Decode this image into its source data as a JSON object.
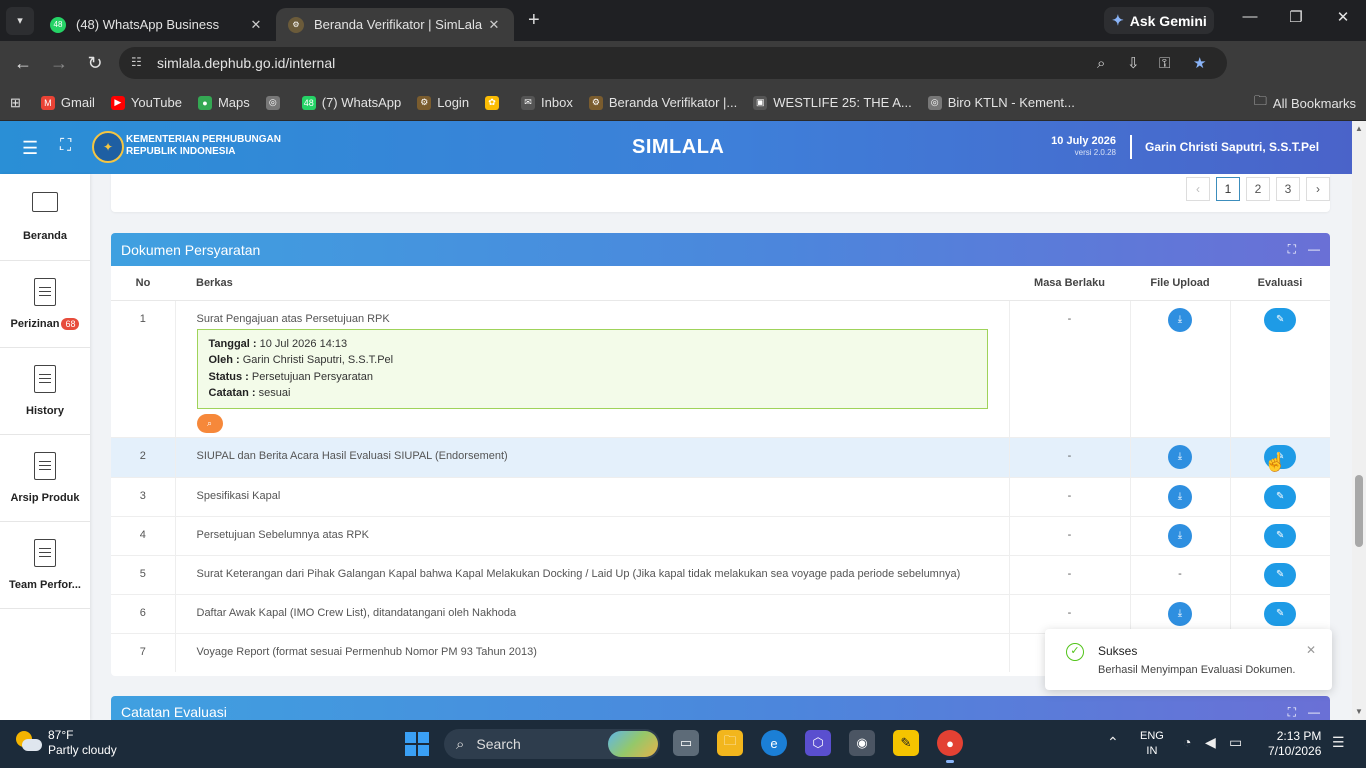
{
  "browser": {
    "tabs": [
      {
        "title": "(48) WhatsApp Business",
        "favicon_text": "48",
        "color": "#25d366",
        "active": false
      },
      {
        "title": "Beranda Verifikator | SimLala",
        "favicon_text": "⚙",
        "color": "#6b5b3a",
        "active": true
      }
    ],
    "gemini_label": "Ask Gemini",
    "url": "simlala.dephub.go.id/internal",
    "bookmarks": [
      {
        "label": "Gmail",
        "icon": "gmail-icon",
        "color": "#ea4335",
        "glyph": "M"
      },
      {
        "label": "YouTube",
        "icon": "youtube-icon",
        "color": "#ff0000",
        "glyph": "▶"
      },
      {
        "label": "Maps",
        "icon": "maps-icon",
        "color": "#34a853",
        "glyph": "●"
      },
      {
        "label": "",
        "icon": "globe-icon",
        "color": "#777777",
        "glyph": "◎"
      },
      {
        "label": "(7) WhatsApp",
        "icon": "whatsapp-icon",
        "color": "#25d366",
        "glyph": "48"
      },
      {
        "label": "Login",
        "icon": "site-icon",
        "color": "#7a5c2e",
        "glyph": "⚙"
      },
      {
        "label": "",
        "icon": "pinwheel-icon",
        "color": "#fbbc04",
        "glyph": "✿"
      },
      {
        "label": "Inbox",
        "icon": "mail-icon",
        "color": "#555555",
        "glyph": "✉"
      },
      {
        "label": "Beranda Verifikator |...",
        "icon": "site-icon",
        "color": "#7a5c2e",
        "glyph": "⚙"
      },
      {
        "label": "WESTLIFE 25: THE A...",
        "icon": "page-icon",
        "color": "#ffffff",
        "glyph": "▣"
      },
      {
        "label": "Biro KTLN - Kement...",
        "icon": "globe-icon",
        "color": "#777777",
        "glyph": "◎"
      }
    ],
    "all_bookmarks": "All Bookmarks"
  },
  "app": {
    "org_line1": "KEMENTERIAN PERHUBUNGAN",
    "org_line2": "REPUBLIK INDONESIA",
    "title": "SIMLALA",
    "date": "10 July 2026",
    "version": "versi 2.0.28",
    "user": "Garin Christi Saputri, S.S.T.Pel"
  },
  "sidebar": {
    "items": [
      {
        "label": "Beranda",
        "icon": "monitor-icon"
      },
      {
        "label": "Perizinan",
        "icon": "document-icon",
        "badge": "68"
      },
      {
        "label": "History",
        "icon": "document-icon"
      },
      {
        "label": "Arsip Produk",
        "icon": "document-icon"
      },
      {
        "label": "Team Perfor...",
        "icon": "document-icon"
      }
    ]
  },
  "pager": {
    "prev": "‹",
    "pages": [
      "1",
      "2",
      "3"
    ],
    "next": "›",
    "active": "1"
  },
  "dokumen": {
    "title": "Dokumen Persyaratan",
    "columns": {
      "no": "No",
      "berkas": "Berkas",
      "masa": "Masa Berlaku",
      "file": "File Upload",
      "eval": "Evaluasi"
    },
    "rows": [
      {
        "no": "1",
        "berkas": "Surat Pengajuan atas Persetujuan RPK",
        "masa": "-"
      },
      {
        "no": "2",
        "berkas": "SIUPAL dan Berita Acara Hasil Evaluasi SIUPAL (Endorsement)",
        "masa": "-"
      },
      {
        "no": "3",
        "berkas": "Spesifikasi Kapal",
        "masa": "-"
      },
      {
        "no": "4",
        "berkas": "Persetujuan Sebelumnya atas RPK",
        "masa": "-"
      },
      {
        "no": "5",
        "berkas": "Surat Keterangan dari Pihak Galangan Kapal bahwa Kapal Melakukan Docking / Laid Up (Jika kapal tidak melakukan sea voyage pada periode sebelumnya)",
        "masa": "-",
        "file": "-"
      },
      {
        "no": "6",
        "berkas": "Daftar Awak Kapal (IMO Crew List), ditandatangani oleh Nakhoda",
        "masa": "-"
      },
      {
        "no": "7",
        "berkas": "Voyage Report (format sesuai Permenhub Nomor PM 93 Tahun 2013)",
        "masa": "-"
      }
    ],
    "evaluation": {
      "tanggal_label": "Tanggal :",
      "tanggal": "10 Jul 2026 14:13",
      "oleh_label": "Oleh :",
      "oleh": "Garin Christi Saputri, S.S.T.Pel",
      "status_label": "Status :",
      "status": "Persetujuan Persyaratan",
      "catatan_label": "Catatan :",
      "catatan": "sesuai"
    }
  },
  "catatan": {
    "title": "Catatan Evaluasi"
  },
  "toast": {
    "title": "Sukses",
    "message": "Berhasil Menyimpan Evaluasi Dokumen."
  },
  "taskbar": {
    "temp": "87°F",
    "weather": "Partly cloudy",
    "search": "Search",
    "lang1": "ENG",
    "lang2": "IN",
    "time": "2:13 PM",
    "date": "7/10/2026"
  }
}
